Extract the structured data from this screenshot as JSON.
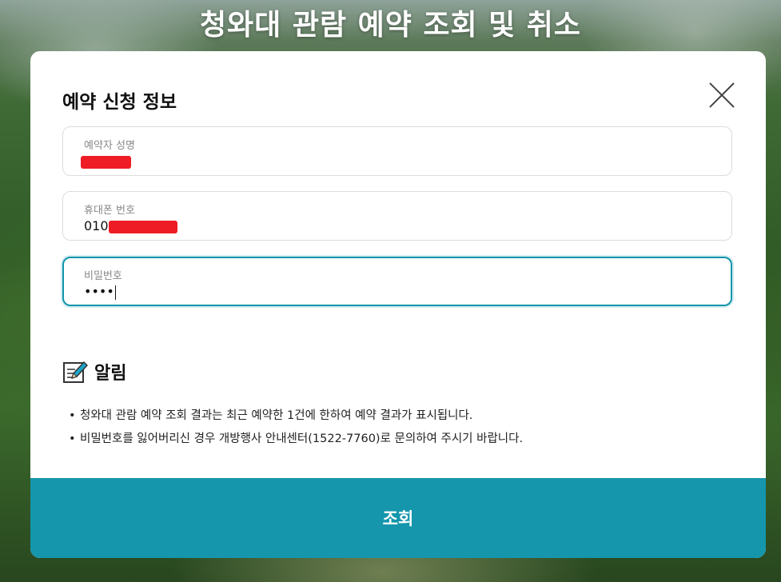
{
  "page": {
    "title": "청와대 관람 예약 조회 및 취소"
  },
  "modal": {
    "title": "예약 신청 정보",
    "close_icon": "close-icon",
    "fields": {
      "name": {
        "label": "예약자 성명",
        "value_redacted": true
      },
      "phone": {
        "label": "휴대폰 번호",
        "value_prefix": "010",
        "value_redacted": true
      },
      "password": {
        "label": "비밀번호",
        "value": "••••",
        "focused": true
      }
    },
    "notice": {
      "icon": "pencil-note-icon",
      "title": "알림",
      "items": [
        "청와대 관람 예약 조회 결과는 최근 예약한 1건에 한하여 예약 결과가 표시됩니다.",
        "비밀번호를 잃어버리신 경우 개방행사 안내센터(1522-7760)로 문의하여 주시기 바랍니다."
      ]
    },
    "submit_label": "조회"
  },
  "colors": {
    "accent": "#1596ac",
    "focus_border": "#1396ab",
    "redaction": "#ee1c24"
  }
}
